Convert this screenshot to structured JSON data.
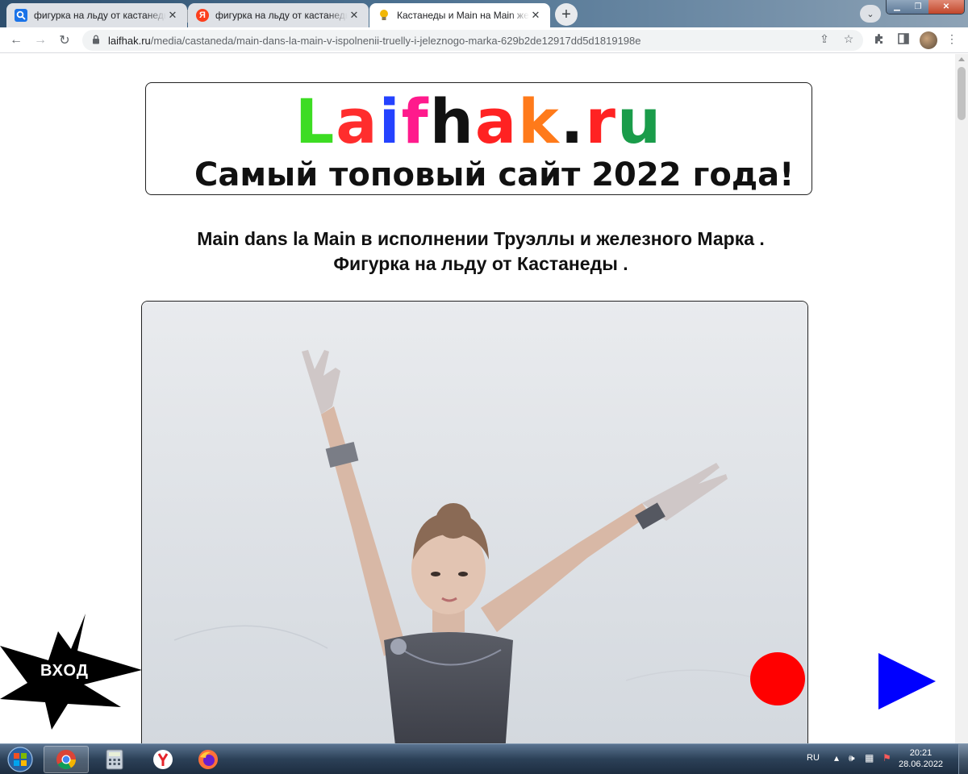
{
  "browser": {
    "tabs": [
      {
        "title": "фигурка на льду от кастанеды я",
        "favicon": "search-icon",
        "color": "#1a73e8",
        "active": false
      },
      {
        "title": "фигурка на льду от кастанеды я",
        "favicon": "yandex-icon",
        "color": "#fc3f1d",
        "active": false
      },
      {
        "title": "Кастанеды и Main на Main желе",
        "favicon": "lightbulb-icon",
        "color": "#f2b705",
        "active": true
      }
    ],
    "new_tab_symbol": "+",
    "tab_search_symbol": "⌄",
    "window": {
      "minimize": "▁",
      "maximize": "❐",
      "close": "✕"
    },
    "nav": {
      "back": "←",
      "forward": "→",
      "reload": "↻"
    },
    "address": {
      "host": "laifhak.ru",
      "path": "/media/castaneda/main-dans-la-main-v-ispolnenii-truelly-i-jeleznogo-marka-629b2de12917dd5d1819198e"
    },
    "icons": {
      "share": "⇪",
      "star": "☆",
      "extensions": "✚",
      "sidepanel": "▣",
      "menu": "⋮",
      "lock": "🔒"
    }
  },
  "page": {
    "logo_letters": [
      {
        "ch": "L",
        "color": "#3ddc23"
      },
      {
        "ch": "a",
        "color": "#ff2d2d"
      },
      {
        "ch": "i",
        "color": "#2442ff"
      },
      {
        "ch": "f",
        "color": "#ff1a8c"
      },
      {
        "ch": "h",
        "color": "#111111"
      },
      {
        "ch": "a",
        "color": "#ff2222"
      },
      {
        "ch": "k",
        "color": "#ff7a1a"
      },
      {
        "ch": ".",
        "color": "#111111"
      },
      {
        "ch": "r",
        "color": "#ff2222"
      },
      {
        "ch": "u",
        "color": "#1a9c4a"
      }
    ],
    "tagline": "Самый топовый сайт 2022 года!",
    "headline_line1": "Main dans la Main в исполнении Труэллы и железного Марка .",
    "headline_line2": "Фигурка на льду от Кастанеды .",
    "enter_label": "ВХОД",
    "accent_red": "#ff0000",
    "accent_blue": "#0000ff"
  },
  "taskbar": {
    "apps": [
      "chrome-icon",
      "calculator-icon",
      "yandex-browser-icon",
      "firefox-icon"
    ],
    "lang": "RU",
    "time": "20:21",
    "date": "28.06.2022"
  }
}
